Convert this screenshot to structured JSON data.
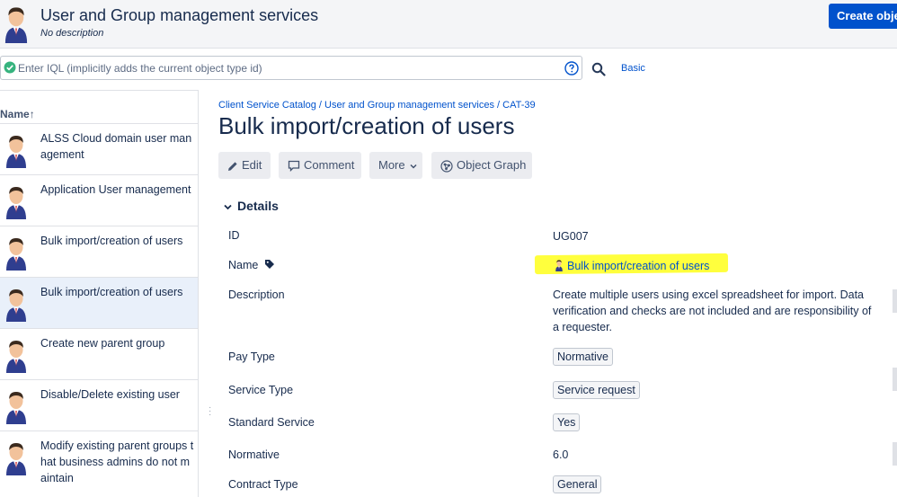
{
  "header": {
    "title": "User and Group management services",
    "description": "No description",
    "create_button": "Create object"
  },
  "search": {
    "placeholder": "Enter IQL (implicitly adds the current object type id)",
    "mode_link": "Basic"
  },
  "list": {
    "column_header": "Name",
    "sort_indicator": "↑",
    "items": [
      {
        "label": "ALSS Cloud domain user management",
        "selected": false
      },
      {
        "label": "Application User management",
        "selected": false
      },
      {
        "label": "Bulk import/creation of users",
        "selected": false
      },
      {
        "label": "Bulk import/creation of users",
        "selected": true
      },
      {
        "label": "Create new parent group",
        "selected": false
      },
      {
        "label": "Disable/Delete existing user",
        "selected": false
      },
      {
        "label": "Modify existing parent groups that business admins do not maintain",
        "selected": false
      }
    ]
  },
  "detail": {
    "breadcrumb": [
      "Client Service Catalog",
      "User and Group management services",
      "CAT-39"
    ],
    "title": "Bulk import/creation of users",
    "actions": {
      "edit": "Edit",
      "comment": "Comment",
      "more": "More",
      "graph": "Object Graph"
    },
    "section": "Details",
    "fields": {
      "id_label": "ID",
      "id_value": "UG007",
      "name_label": "Name",
      "name_value": "Bulk import/creation of users",
      "desc_label": "Description",
      "desc_value": "Create multiple users using excel spreadsheet for import. Data verification and checks are not included and are responsibility of a requester.",
      "pay_label": "Pay Type",
      "pay_value": "Normative",
      "service_label": "Service Type",
      "service_value": "Service request",
      "standard_label": "Standard Service",
      "standard_value": "Yes",
      "normative_label": "Normative",
      "normative_value": "6.0",
      "contract_label": "Contract Type",
      "contract_value": "General"
    }
  },
  "colors": {
    "accent": "#0052cc",
    "highlight": "#ffff3d",
    "selected_row": "#e9f0fa",
    "status_ok": "#36b37e"
  }
}
